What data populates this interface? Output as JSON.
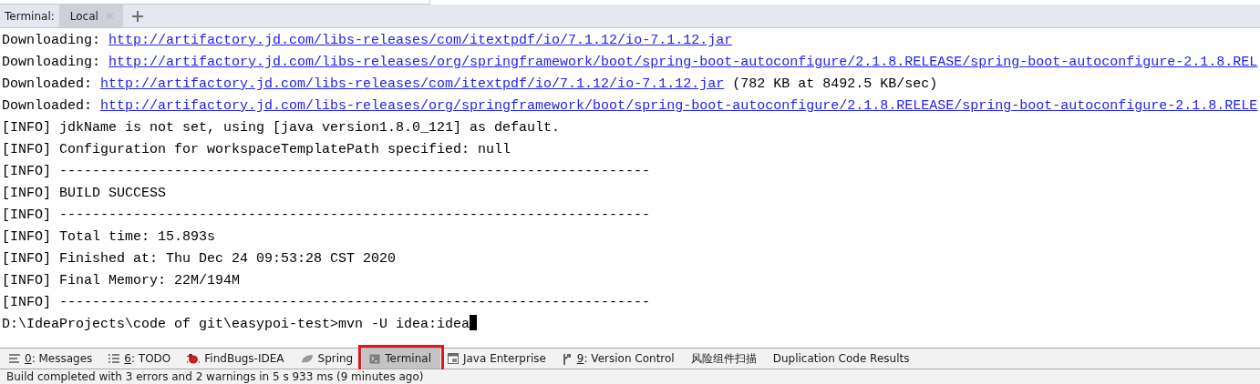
{
  "terminal_tabs": {
    "title": "Terminal:",
    "tabs": [
      {
        "label": "Local",
        "selected": true,
        "closable": true
      }
    ]
  },
  "console": {
    "lines": [
      {
        "parts": [
          {
            "kind": "text",
            "text": "Downloading: "
          },
          {
            "kind": "link",
            "text": "http://artifactory.jd.com/libs-releases/com/itextpdf/io/7.1.12/io-7.1.12.jar"
          }
        ]
      },
      {
        "parts": [
          {
            "kind": "text",
            "text": "Downloading: "
          },
          {
            "kind": "link",
            "text": "http://artifactory.jd.com/libs-releases/org/springframework/boot/spring-boot-autoconfigure/2.1.8.RELEASE/spring-boot-autoconfigure-2.1.8.REL"
          }
        ]
      },
      {
        "parts": [
          {
            "kind": "text",
            "text": "Downloaded: "
          },
          {
            "kind": "link",
            "text": "http://artifactory.jd.com/libs-releases/com/itextpdf/io/7.1.12/io-7.1.12.jar"
          },
          {
            "kind": "text",
            "text": " (782 KB at 8492.5 KB/sec)"
          }
        ]
      },
      {
        "parts": [
          {
            "kind": "text",
            "text": "Downloaded: "
          },
          {
            "kind": "link",
            "text": "http://artifactory.jd.com/libs-releases/org/springframework/boot/spring-boot-autoconfigure/2.1.8.RELEASE/spring-boot-autoconfigure-2.1.8.RELE"
          }
        ]
      },
      {
        "parts": [
          {
            "kind": "text",
            "text": "[INFO] jdkName is not set, using [java version1.8.0_121] as default."
          }
        ]
      },
      {
        "parts": [
          {
            "kind": "text",
            "text": "[INFO] Configuration for workspaceTemplatePath specified: null"
          }
        ]
      },
      {
        "parts": [
          {
            "kind": "text",
            "text": "[INFO] ------------------------------------------------------------------------"
          }
        ]
      },
      {
        "parts": [
          {
            "kind": "text",
            "text": "[INFO] BUILD SUCCESS"
          }
        ]
      },
      {
        "parts": [
          {
            "kind": "text",
            "text": "[INFO] ------------------------------------------------------------------------"
          }
        ]
      },
      {
        "parts": [
          {
            "kind": "text",
            "text": "[INFO] Total time: 15.893s"
          }
        ]
      },
      {
        "parts": [
          {
            "kind": "text",
            "text": "[INFO] Finished at: Thu Dec 24 09:53:28 CST 2020"
          }
        ]
      },
      {
        "parts": [
          {
            "kind": "text",
            "text": "[INFO] Final Memory: 22M/194M"
          }
        ]
      },
      {
        "parts": [
          {
            "kind": "text",
            "text": "[INFO] ------------------------------------------------------------------------"
          }
        ]
      }
    ],
    "prompt": {
      "text": "D:\\IdeaProjects\\code of git\\easypoi-test>mvn -U idea:idea",
      "cursor": true
    }
  },
  "tool_windows": [
    {
      "label": "0: Messages",
      "kind": "messages",
      "mnemonic": true,
      "selected": false,
      "highlighted": false
    },
    {
      "label": "6: TODO",
      "kind": "todo",
      "mnemonic": true,
      "selected": false,
      "highlighted": false
    },
    {
      "label": "FindBugs-IDEA",
      "kind": "bug",
      "mnemonic": false,
      "selected": false,
      "highlighted": false
    },
    {
      "label": "Spring",
      "kind": "leaf",
      "mnemonic": false,
      "selected": false,
      "highlighted": false
    },
    {
      "label": "Terminal",
      "kind": "terminal",
      "mnemonic": false,
      "selected": true,
      "highlighted": true
    },
    {
      "label": "Java Enterprise",
      "kind": "javaee",
      "mnemonic": false,
      "selected": false,
      "highlighted": false
    },
    {
      "label": "9: Version Control",
      "kind": "vcs",
      "mnemonic": true,
      "selected": false,
      "highlighted": false
    },
    {
      "label": "风险组件扫描",
      "kind": "none",
      "mnemonic": false,
      "selected": false,
      "highlighted": false
    },
    {
      "label": "Duplication Code Results",
      "kind": "none",
      "mnemonic": false,
      "selected": false,
      "highlighted": false
    }
  ],
  "status_bar": {
    "text": "Build completed with 3 errors and 2 warnings in 5 s 933 ms (9 minutes ago)"
  }
}
